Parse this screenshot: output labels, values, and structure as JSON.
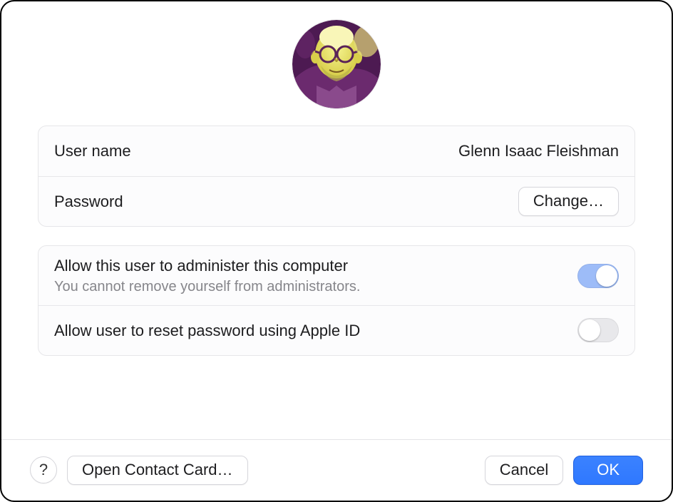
{
  "user": {
    "name_label": "User name",
    "name_value": "Glenn Isaac Fleishman",
    "password_label": "Password",
    "change_button": "Change…"
  },
  "permissions": {
    "admin_label": "Allow this user to administer this computer",
    "admin_subtext": "You cannot remove yourself from administrators.",
    "admin_on": true,
    "reset_label": "Allow user to reset password using Apple ID",
    "reset_on": false
  },
  "footer": {
    "help_label": "?",
    "open_contact": "Open Contact Card…",
    "cancel": "Cancel",
    "ok": "OK"
  }
}
